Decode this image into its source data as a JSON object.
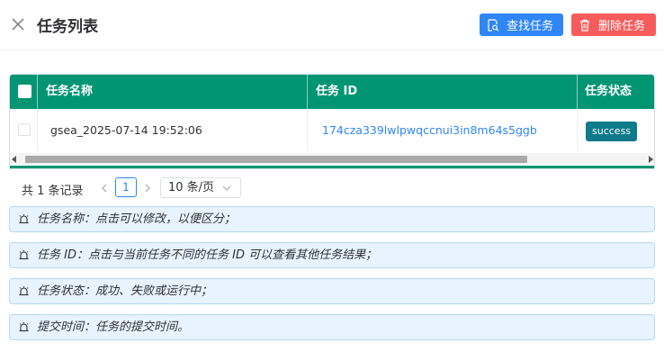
{
  "header": {
    "title": "任务列表",
    "search_label": "查找任务",
    "delete_label": "删除任务"
  },
  "table": {
    "columns": [
      "任务名称",
      "任务 ID",
      "任务状态"
    ],
    "rows": [
      {
        "name": "gsea_2025-07-14 19:52:06",
        "id": "174cza339lwlpwqccnui3in8m64s5ggb",
        "status": "success"
      }
    ]
  },
  "pagination": {
    "total_text": "共 1 条记录",
    "current_page": "1",
    "page_size": "10 条/页"
  },
  "tips": [
    "任务名称：点击可以修改，以便区分；",
    "任务 ID：点击与当前任务不同的任务 ID 可以查看其他任务结果；",
    "任务状态：成功、失败或运行中；",
    "提交时间：任务的提交时间。"
  ],
  "colors": {
    "header_green": "#019574",
    "primary_blue": "#2f86f6",
    "danger_red": "#f75c5c",
    "status_badge": "#0f7a8a",
    "tip_bg": "#e7f3fe"
  },
  "icons": {
    "close": "close-icon",
    "search": "search-file-icon",
    "delete": "trash-icon",
    "tip": "alarm-bell-icon"
  }
}
